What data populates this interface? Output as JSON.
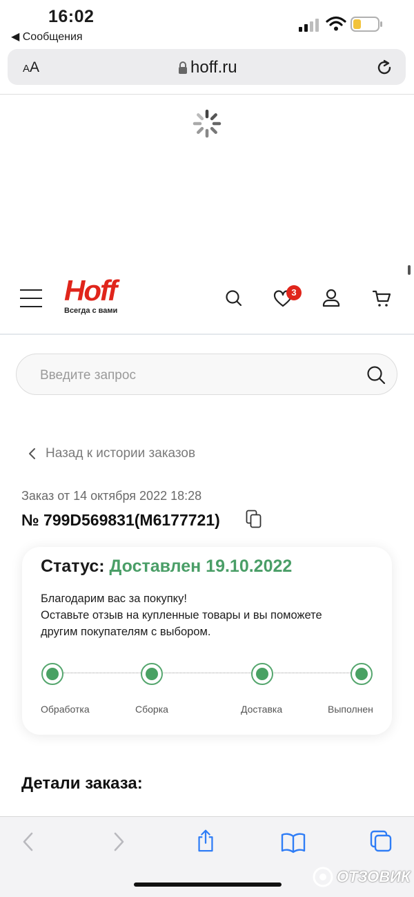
{
  "status_bar": {
    "time": "16:02",
    "back_app": "◀ Сообщения"
  },
  "browser": {
    "aa_small": "A",
    "aa_big": "A",
    "url": "hoff.ru"
  },
  "header": {
    "logo_text": "Hoff",
    "logo_tagline": "Всегда с вами",
    "favorites_count": "3",
    "brand_color": "#e0251b"
  },
  "search": {
    "placeholder": "Введите запрос"
  },
  "order": {
    "back_link": "Назад к истории заказов",
    "date": "Заказ от 14 октября 2022 18:28",
    "number": "№ 799D569831(M6177721)"
  },
  "status_card": {
    "status_label": "Статус:",
    "status_value": "Доставлен 19.10.2022",
    "status_color": "#4a9e67",
    "thanks_line1": "Благодарим вас за покупку!",
    "thanks_line2": "Оставьте отзыв на купленные товары и вы поможете",
    "thanks_line3": "другим покупателям с выбором.",
    "steps": [
      "Обработка",
      "Сборка",
      "Доставка",
      "Выполнен"
    ]
  },
  "details_heading": "Детали заказа:",
  "watermark": "ОТЗОВИК"
}
